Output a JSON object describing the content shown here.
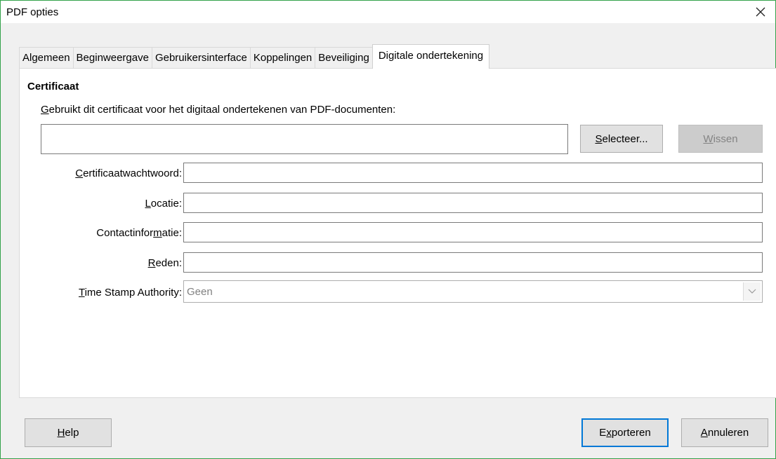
{
  "window": {
    "title": "PDF opties",
    "close_icon": "close-icon"
  },
  "tabs": [
    {
      "label": "Algemeen"
    },
    {
      "label": "Beginweergave"
    },
    {
      "label": "Gebruikersinterface"
    },
    {
      "label": "Koppelingen"
    },
    {
      "label": "Beveiliging"
    },
    {
      "label": "Digitale ondertekening",
      "active": true
    }
  ],
  "certificate": {
    "section_title": "Certificaat",
    "description_first": "G",
    "description_rest": "ebruikt dit certificaat voor het digitaal ondertekenen van PDF-documenten:",
    "value": "",
    "select_button": {
      "mnemonic": "S",
      "rest": "electeer..."
    },
    "clear_button": {
      "mnemonic": "W",
      "rest": "issen"
    }
  },
  "fields": {
    "password": {
      "mnemonic": "C",
      "rest": "ertificaatwachtwoord:",
      "value": ""
    },
    "location": {
      "mnemonic": "L",
      "rest": "ocatie:",
      "value": ""
    },
    "contact": {
      "before": "Contactinfor",
      "mnemonic": "m",
      "after": "atie:",
      "value": ""
    },
    "reason": {
      "mnemonic": "R",
      "rest": "eden:",
      "value": ""
    },
    "tsa": {
      "mnemonic": "T",
      "rest": "ime Stamp Authority:",
      "selected": "Geen"
    }
  },
  "footer": {
    "help": {
      "mnemonic": "H",
      "rest": "elp"
    },
    "export": {
      "before": "E",
      "mnemonic": "x",
      "after": "porteren"
    },
    "cancel": {
      "mnemonic": "A",
      "rest": "nnuleren"
    }
  },
  "colors": {
    "window_border": "#33a24a",
    "default_button_border": "#0078d7"
  }
}
